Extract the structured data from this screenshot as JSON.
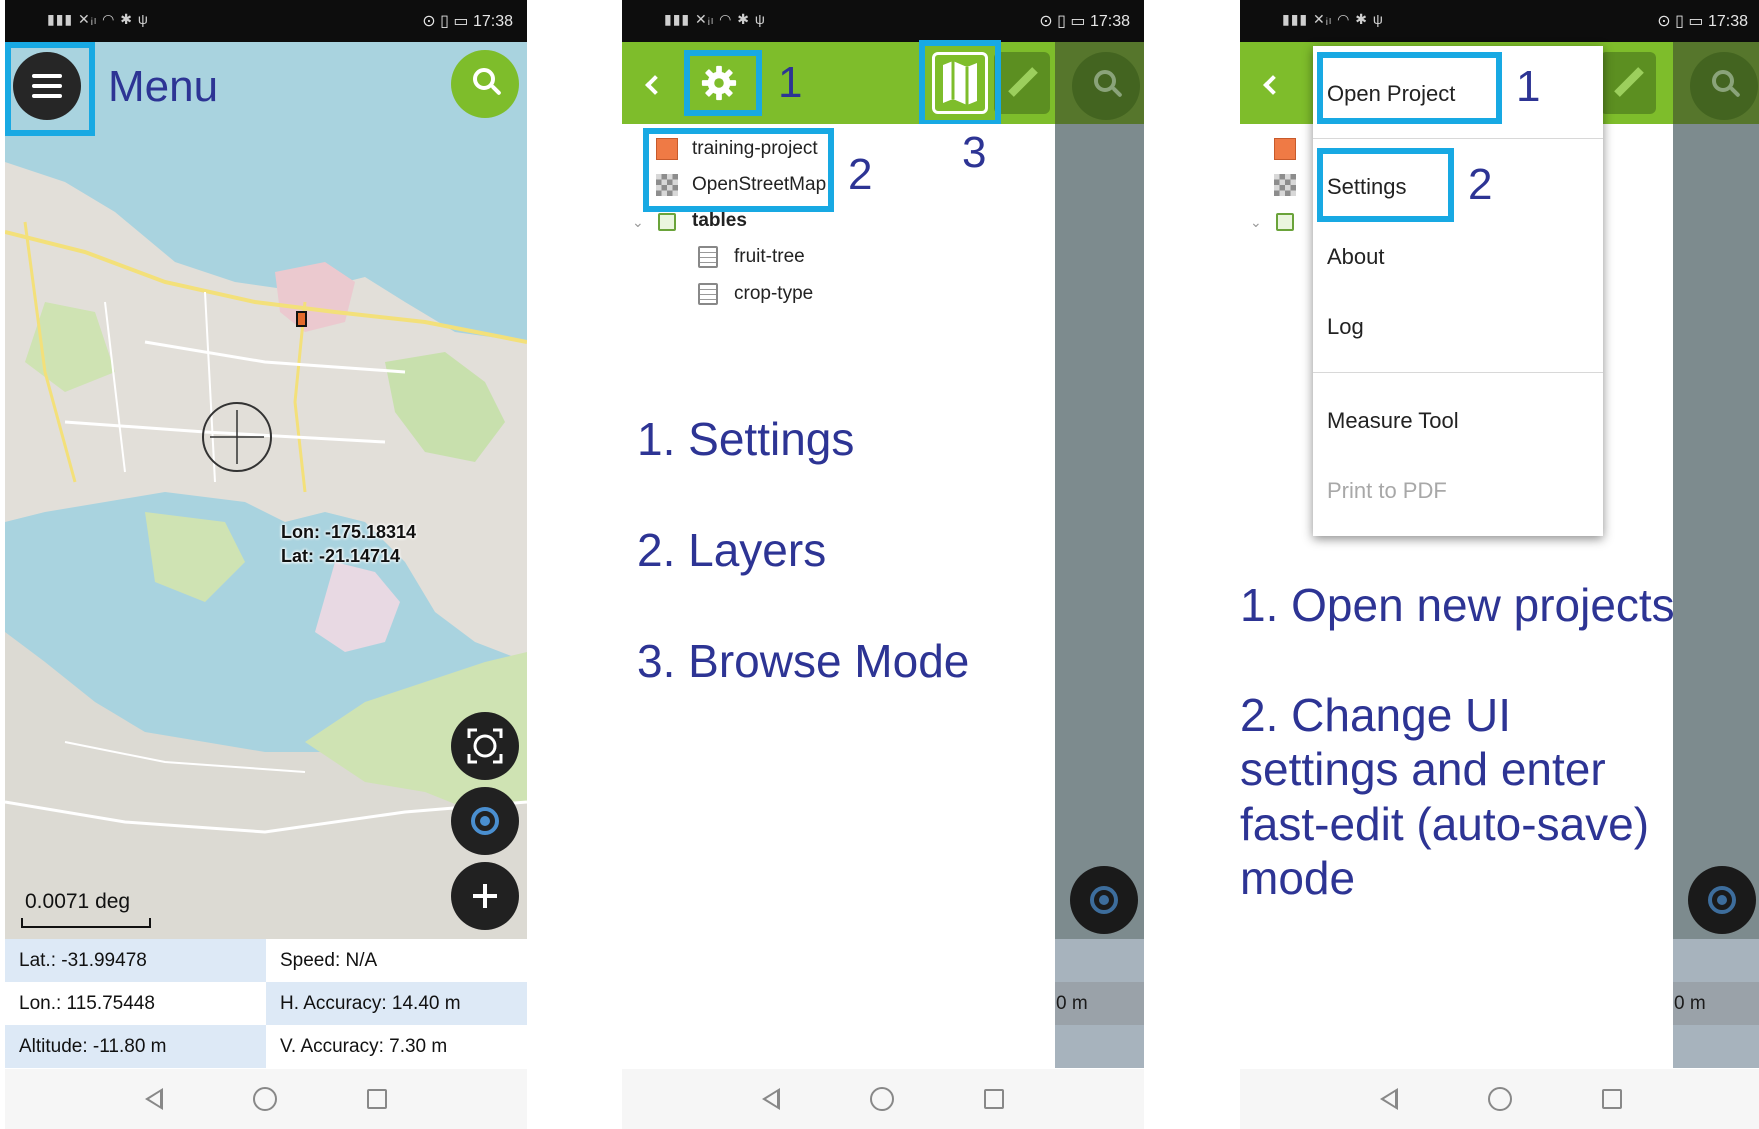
{
  "status": {
    "time": "17:38",
    "left_glyphs": "▮▮▮ ✕ᵢₗ ◠ ✱ ψ",
    "right_glyphs": "⊙ ▯ ▭"
  },
  "panel1": {
    "title": "Menu",
    "coords": {
      "lon": "Lon: -175.18314",
      "lat": "Lat: -21.14714"
    },
    "scale": "0.0071 deg",
    "info": {
      "lat": "Lat.: -31.99478",
      "speed": "Speed: N/A",
      "lon": "Lon.: 115.75448",
      "h_accuracy": "H. Accuracy: 14.40 m",
      "altitude": "Altitude: -11.80 m",
      "v_accuracy": "V. Accuracy: 7.30 m"
    }
  },
  "panel2": {
    "markers": {
      "one": "1",
      "two": "2",
      "three": "3"
    },
    "layers": [
      {
        "label": "training-project"
      },
      {
        "label": "OpenStreetMap"
      }
    ],
    "group": "tables",
    "tables": [
      {
        "label": "fruit-tree"
      },
      {
        "label": "crop-type"
      }
    ],
    "captions": [
      "1. Settings",
      "2. Layers",
      "3. Browse Mode"
    ],
    "dim_text": "0 m"
  },
  "panel3": {
    "markers": {
      "one": "1",
      "two": "2"
    },
    "menu_items": {
      "open_project": "Open Project",
      "settings": "Settings",
      "about": "About",
      "log": "Log",
      "measure_tool": "Measure Tool",
      "print_pdf": "Print to PDF"
    },
    "captions": [
      "1. Open new projects",
      "2. Change UI settings and enter fast-edit (auto-save) mode"
    ],
    "dim_text": "0 m"
  },
  "colors": {
    "accent_green": "#7ebd2b",
    "highlight_blue": "#18a9e3",
    "caption_navy": "#2d3494"
  }
}
